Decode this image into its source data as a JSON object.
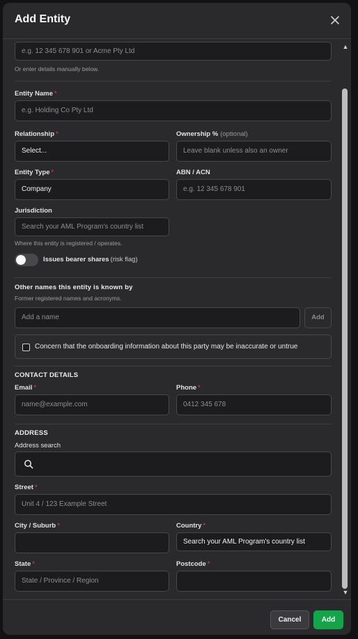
{
  "modal": {
    "title": "Add Entity"
  },
  "lookup": {
    "placeholder": "e.g. 12 345 678 901 or Acme Pty Ltd",
    "hint": "Or enter details manually below."
  },
  "entity_name": {
    "label": "Entity Name",
    "required": "*",
    "placeholder": "e.g. Holding Co Pty Ltd"
  },
  "relationship": {
    "label": "Relationship",
    "required": "*",
    "value": "Select..."
  },
  "ownership": {
    "label": "Ownership %",
    "optional": "(optional)",
    "placeholder": "Leave blank unless also an owner"
  },
  "entity_type": {
    "label": "Entity Type",
    "required": "*",
    "value": "Company"
  },
  "abn": {
    "label": "ABN / ACN",
    "placeholder": "e.g. 12 345 678 901"
  },
  "jurisdiction": {
    "label": "Jurisdiction",
    "placeholder": "Search your AML Program's country list",
    "hint": "Where this entity is registered / operates."
  },
  "bearer": {
    "label": "Issues bearer shares",
    "flag": "(risk flag)",
    "on": false
  },
  "other_names": {
    "title": "Other names this entity is known by",
    "subtitle": "Former registered names and acronyms.",
    "placeholder": "Add a name",
    "add_label": "Add"
  },
  "concern": {
    "label": "Concern that the onboarding information about this party may be inaccurate or untrue"
  },
  "contact": {
    "title": "CONTACT DETAILS",
    "email": {
      "label": "Email",
      "required": "*",
      "placeholder": "name@example.com"
    },
    "phone": {
      "label": "Phone",
      "required": "*",
      "placeholder": "0412 345 678"
    }
  },
  "address": {
    "title": "ADDRESS",
    "search_label": "Address search",
    "street": {
      "label": "Street",
      "required": "*",
      "placeholder": "Unit 4 / 123 Example Street"
    },
    "city": {
      "label": "City / Suburb",
      "required": "*",
      "placeholder": ""
    },
    "country": {
      "label": "Country",
      "required": "*",
      "value": "Search your AML Program's country list"
    },
    "state": {
      "label": "State",
      "required": "*",
      "placeholder": "State / Province / Region"
    },
    "postcode": {
      "label": "Postcode",
      "required": "*",
      "placeholder": ""
    }
  },
  "footer": {
    "cancel": "Cancel",
    "add": "Add"
  },
  "icons": {
    "close": "close-icon",
    "search": "search-icon",
    "scroll_up": "chevron-up-icon",
    "scroll_down": "chevron-down-icon"
  },
  "colors": {
    "accent": "#16a34a",
    "required": "#ef4444",
    "surface": "#2a2a2d"
  }
}
